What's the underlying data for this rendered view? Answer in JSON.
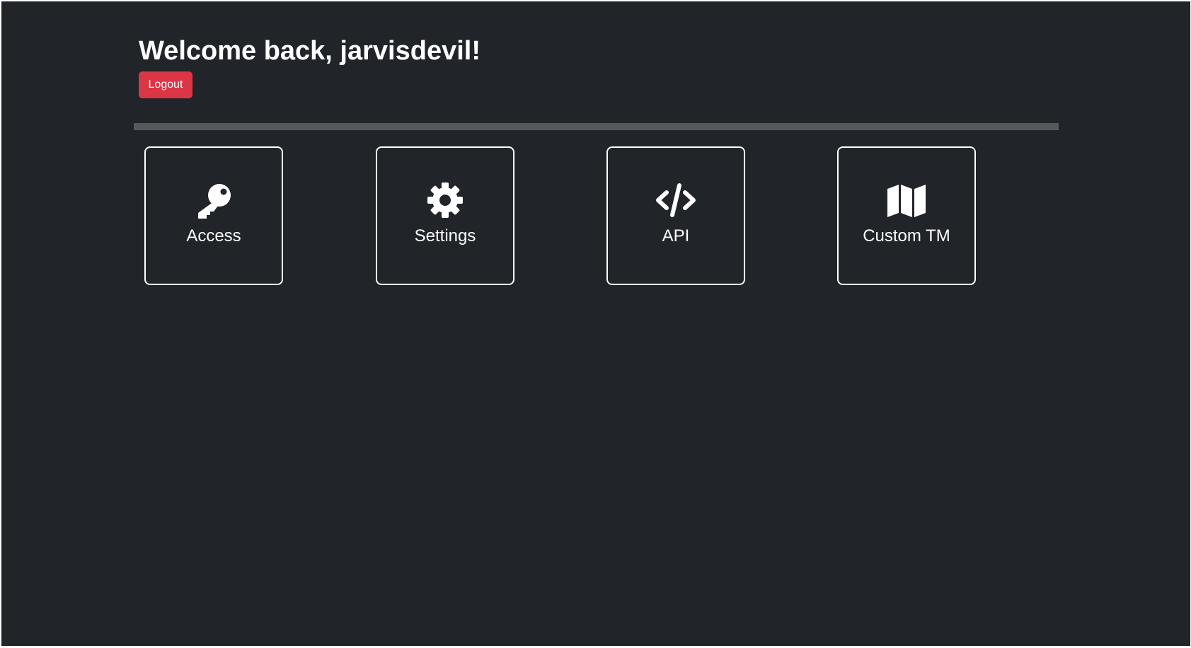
{
  "header": {
    "welcome_text": "Welcome back, jarvisdevil!",
    "logout_label": "Logout"
  },
  "tiles": [
    {
      "label": "Access",
      "icon": "key-icon"
    },
    {
      "label": "Settings",
      "icon": "gear-icon"
    },
    {
      "label": "API",
      "icon": "code-icon"
    },
    {
      "label": "Custom TM",
      "icon": "map-icon"
    }
  ],
  "colors": {
    "background": "#212529",
    "danger": "#dc3545",
    "divider": "#55595c",
    "text": "#ffffff"
  }
}
